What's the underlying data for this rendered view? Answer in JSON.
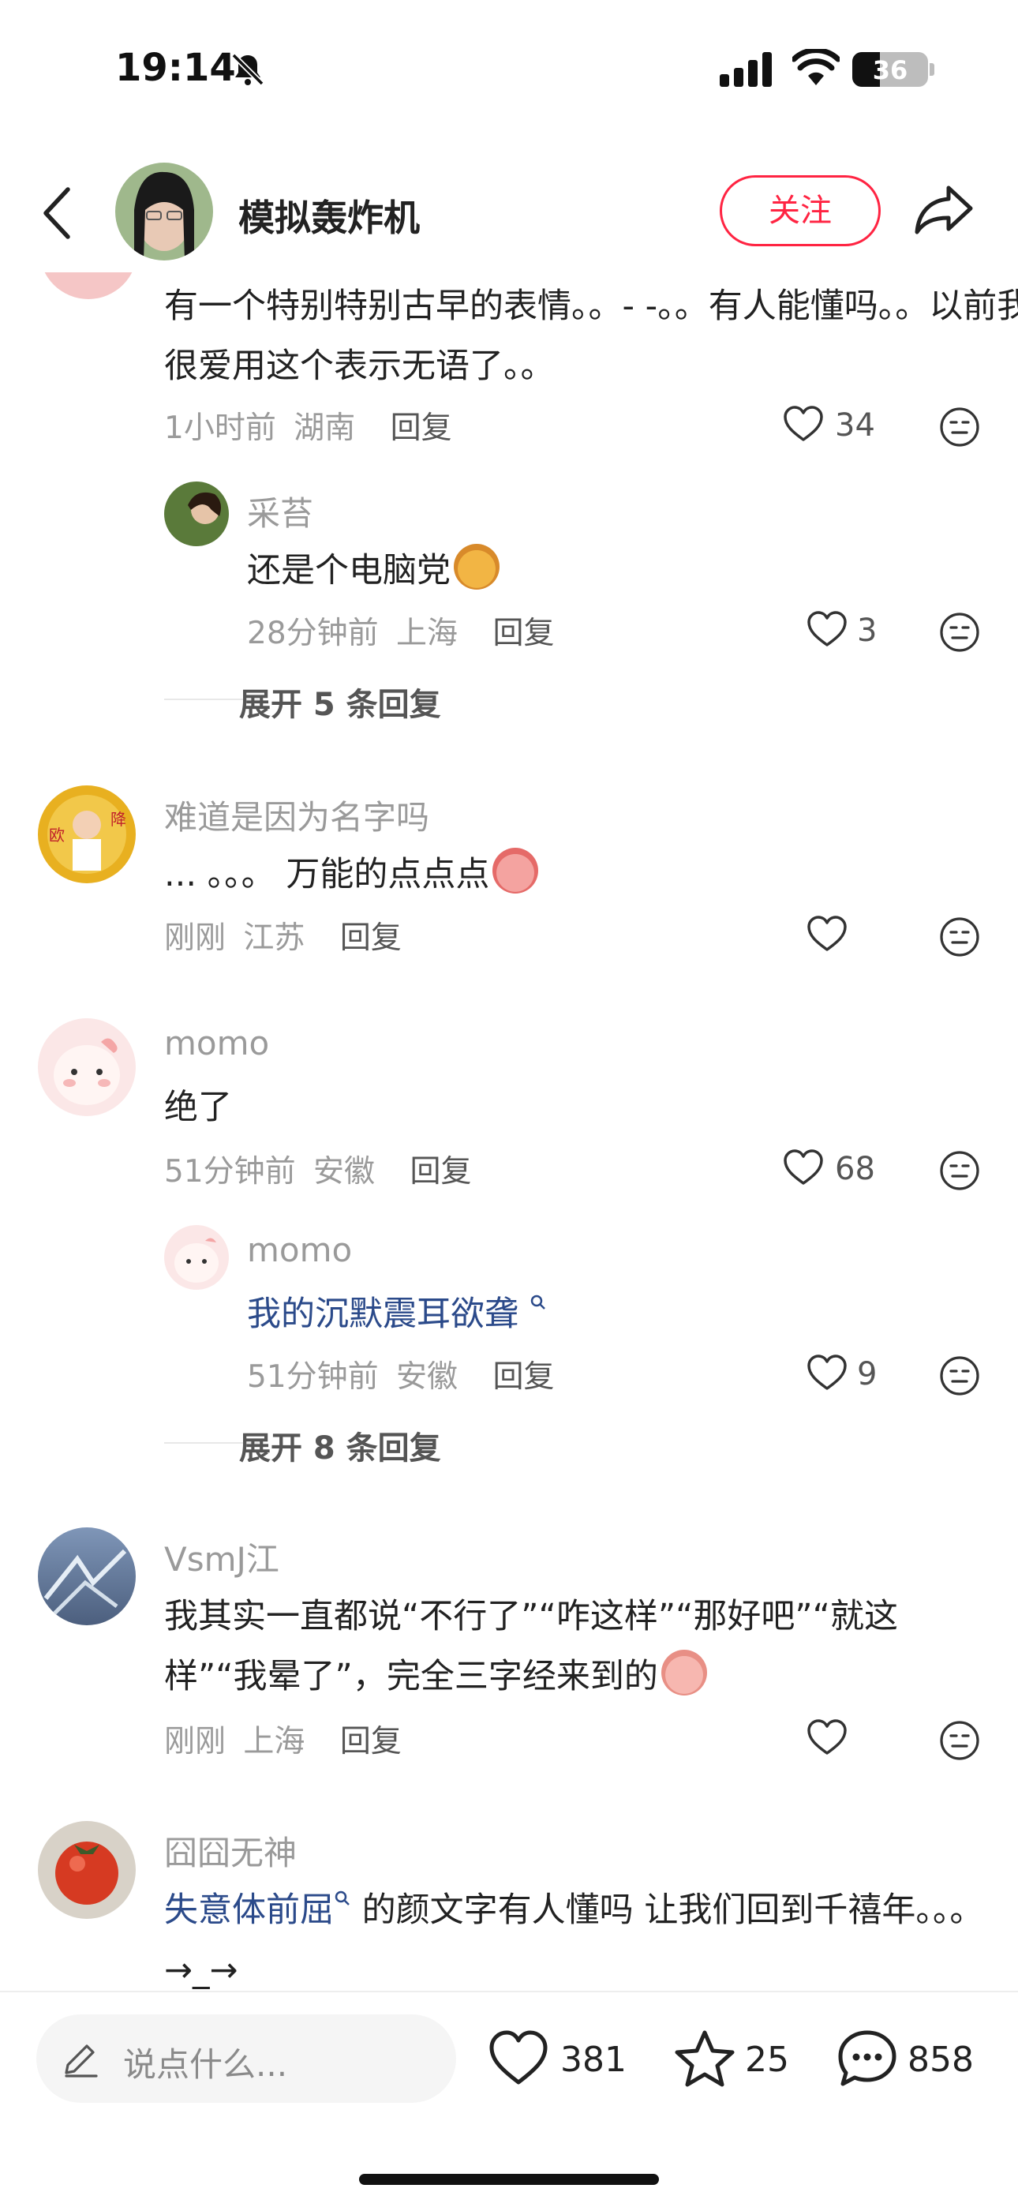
{
  "status_bar": {
    "time": "19:14",
    "battery": "36"
  },
  "header": {
    "author_name": "模拟轰炸机",
    "follow_label": "关注"
  },
  "comments": [
    {
      "text": "有一个特别特别古早的表情。。- -。。有人能懂吗。。以前我很爱用这个表示无语了。。",
      "time": "1小时前",
      "location": "湖南",
      "reply_label": "回复",
      "likes": "34",
      "replies": [
        {
          "nick": "采苔",
          "text": "还是个电脑党",
          "time": "28分钟前",
          "location": "上海",
          "reply_label": "回复",
          "likes": "3"
        }
      ],
      "expand_label": "展开 5 条回复"
    },
    {
      "nick": "难道是因为名字吗",
      "text": "... 。。。 万能的点点点",
      "time": "刚刚",
      "location": "江苏",
      "reply_label": "回复",
      "likes": ""
    },
    {
      "nick": "momo",
      "text": "绝了",
      "time": "51分钟前",
      "location": "安徽",
      "reply_label": "回复",
      "likes": "68",
      "replies": [
        {
          "nick": "momo",
          "text": "我的沉默震耳欲聋",
          "time": "51分钟前",
          "location": "安徽",
          "reply_label": "回复",
          "likes": "9"
        }
      ],
      "expand_label": "展开 8 条回复"
    },
    {
      "nick": "VsmJ江",
      "text": "我其实一直都说“不行了”“咋这样”“那好吧”“就这样”“我晕了”，完全三字经来到的",
      "time": "刚刚",
      "location": "上海",
      "reply_label": "回复",
      "likes": ""
    },
    {
      "nick": "囧囧无神",
      "text_link": "失意体前屈",
      "text": " 的颜文字有人懂吗 让我们回到千禧年。。。 →_→"
    }
  ],
  "bottom_bar": {
    "input_placeholder": "说点什么...",
    "likes": "381",
    "favorites": "25",
    "comments": "858"
  },
  "colors": {
    "accent": "#ff2442",
    "link": "#2b4a8a",
    "muted": "#9a9a9a"
  },
  "icons": [
    "bell-slash-icon",
    "signal-icon",
    "wifi-icon",
    "battery-icon",
    "back-icon",
    "share-icon",
    "heart-icon",
    "emoji-face-icon",
    "pen-icon",
    "star-icon",
    "chat-bubble-icon"
  ]
}
